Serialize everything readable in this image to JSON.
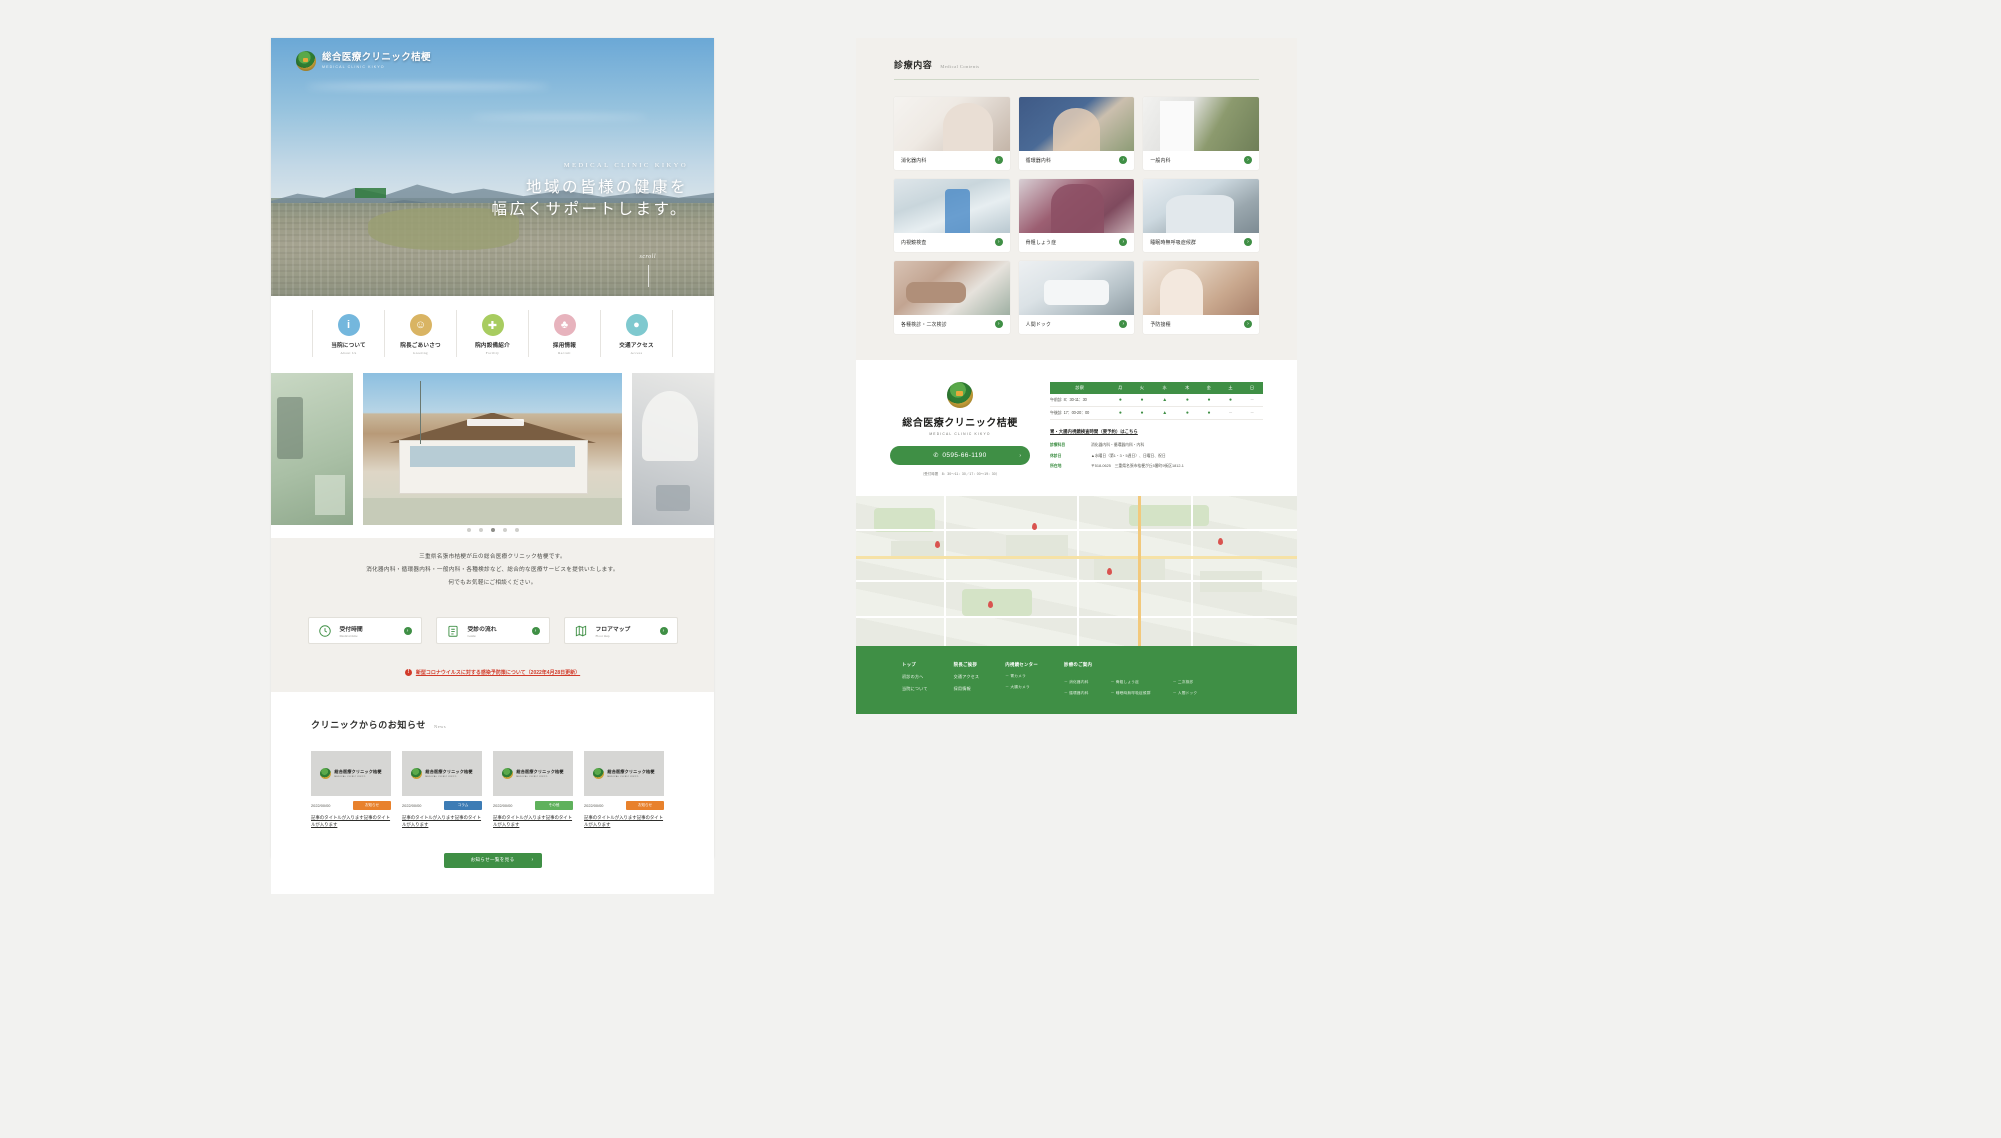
{
  "site": {
    "logo_jp": "総合医療クリニック桔梗",
    "logo_en": "MEDICAL CLINIC KIKYO"
  },
  "hero": {
    "eyebrow": "MEDICAL CLINIC KIKYO",
    "line1": "地域の皆様の健康を",
    "line2": "幅広くサポートします。",
    "scroll": "scroll"
  },
  "iconnav": [
    {
      "jp": "当院について",
      "en": "About Us",
      "icon": "info-icon",
      "color": "#74b7dd",
      "glyph": "i"
    },
    {
      "jp": "院長ごあいさつ",
      "en": "Greeting",
      "icon": "doctor-icon",
      "color": "#d9b463",
      "glyph": "☺"
    },
    {
      "jp": "院内設備紹介",
      "en": "Facility",
      "icon": "hospital-icon",
      "color": "#a8cc60",
      "glyph": "✚"
    },
    {
      "jp": "採用情報",
      "en": "Recruit",
      "icon": "people-icon",
      "color": "#e7b3bd",
      "glyph": "♣"
    },
    {
      "jp": "交通アクセス",
      "en": "Access",
      "icon": "map-pin-icon",
      "color": "#7fc9cf",
      "glyph": "●"
    }
  ],
  "slider": {
    "dots": [
      false,
      false,
      true,
      false,
      false
    ]
  },
  "intro": {
    "line1": "三重県名張市桔梗が丘の総合医療クリニック桔梗です。",
    "line2": "消化器内科・循環器内科・一般内科・各種検診など、総合的な医療サービスを提供いたします。",
    "line3": "何でもお気軽にご相談ください。"
  },
  "quick_buttons": [
    {
      "jp": "受付時間",
      "en": "Medical time",
      "icon": "clock-icon"
    },
    {
      "jp": "受診の流れ",
      "en": "Guide",
      "icon": "clipboard-icon"
    },
    {
      "jp": "フロアマップ",
      "en": "Floor map",
      "icon": "floormap-icon"
    }
  ],
  "covid": {
    "text": "新型コロナウイルスに対する感染予防策について（2022年4月28日更新）"
  },
  "news": {
    "title_jp": "クリニックからのお知らせ",
    "title_en": "News",
    "more_label": "お知らせ一覧を見る",
    "items": [
      {
        "date": "2022/00/00",
        "tag": "お知らせ",
        "tag_color": "tag-orange",
        "title": "記事のタイトルが入ります記事のタイトルが入ります"
      },
      {
        "date": "2022/00/00",
        "tag": "コラム",
        "tag_color": "tag-blue",
        "title": "記事のタイトルが入ります記事のタイトルが入ります"
      },
      {
        "date": "2022/00/00",
        "tag": "その他",
        "tag_color": "tag-green",
        "title": "記事のタイトルが入ります記事のタイトルが入ります"
      },
      {
        "date": "2022/00/00",
        "tag": "お知らせ",
        "tag_color": "tag-orange",
        "title": "記事のタイトルが入ります記事のタイトルが入ります"
      }
    ]
  },
  "medical": {
    "title_jp": "診療内容",
    "title_en": "Medical Contents",
    "cards": [
      {
        "label": "消化器内科",
        "ph": "ph-a"
      },
      {
        "label": "循環器内科",
        "ph": "ph-b"
      },
      {
        "label": "一般内科",
        "ph": "ph-c"
      },
      {
        "label": "内視鏡検査",
        "ph": "ph-d"
      },
      {
        "label": "骨粗しょう症",
        "ph": "ph-e"
      },
      {
        "label": "睡眠時無呼吸症候群",
        "ph": "ph-f"
      },
      {
        "label": "各種検診・二次検診",
        "ph": "ph-g"
      },
      {
        "label": "人間ドック",
        "ph": "ph-h"
      },
      {
        "label": "予防接種",
        "ph": "ph-i"
      }
    ]
  },
  "clinic": {
    "name_jp": "総合医療クリニック桔梗",
    "name_en": "MEDICAL CLINIC KIKYO",
    "tel": "0595-66-1190",
    "tel_note": "（受付時間　8：30～11：30／17：00～19：30）",
    "hours_header": [
      "診察",
      "月",
      "火",
      "水",
      "木",
      "金",
      "土",
      "日"
    ],
    "hours_rows": [
      {
        "name": "午前診",
        "time": "8：30-11：30",
        "marks": [
          "●",
          "●",
          "▲",
          "●",
          "●",
          "●",
          "－"
        ]
      },
      {
        "name": "午後診",
        "time": "17：00-20：00",
        "marks": [
          "●",
          "●",
          "▲",
          "●",
          "●",
          "－",
          "－"
        ]
      }
    ],
    "endoscopy_link": "胃・大腸内視鏡検査時間（要予約）はこちら",
    "details": [
      {
        "key": "診療科目",
        "value": "消化器内科・循環器内科・内科"
      },
      {
        "key": "休診日",
        "value": "▲水曜日（第1・3・5週日）、日曜日、祝日"
      },
      {
        "key": "所在地",
        "value": "〒518-0625　三重県名張市桔梗が丘5番町9街区1812-1"
      }
    ]
  },
  "footer": {
    "col1": [
      "トップ",
      "初診の方へ",
      "当院について"
    ],
    "col2": [
      "院長ご挨拶",
      "交通アクセス",
      "採用情報"
    ],
    "col3": {
      "head": "内視鏡センター",
      "links": [
        "－ 胃カメラ",
        "－ 大腸カメラ"
      ]
    },
    "col4": {
      "head": "診療のご案内",
      "links": [
        "－ 消化器内科",
        "－ 骨粗しょう症",
        "－ 二次検診",
        "－ 循環器内科",
        "－ 睡眠時無呼吸症候群",
        "－ 人間ドック"
      ]
    }
  }
}
